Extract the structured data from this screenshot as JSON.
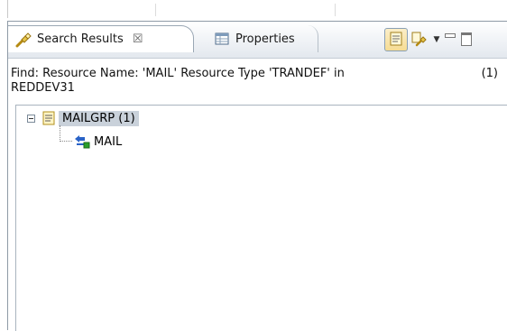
{
  "tabs": [
    {
      "label": "Search Results",
      "icon": "search-flashlight-icon",
      "active": true,
      "close_glyph": "☒"
    },
    {
      "label": "Properties",
      "icon": "properties-table-icon",
      "active": false
    }
  ],
  "toolbar": {
    "buttons": [
      "show-as-tree-icon",
      "pin-search-icon",
      "view-menu-dropdown-icon",
      "minimize-icon",
      "maximize-icon"
    ]
  },
  "search": {
    "query_line1": "Find: Resource Name: 'MAIL' Resource Type 'TRANDEF' in",
    "query_line2": "REDDEV31",
    "count": "(1)"
  },
  "tree": {
    "group": {
      "label": "MAILGRP (1)",
      "icon": "resource-group-icon",
      "expanded": true
    },
    "items": [
      {
        "label": "MAIL",
        "icon": "transaction-definition-icon"
      }
    ]
  },
  "colors": {
    "selection": "#c9d1da",
    "pressed_button": "#f6dc93",
    "tab_border": "#9aa7b4"
  }
}
